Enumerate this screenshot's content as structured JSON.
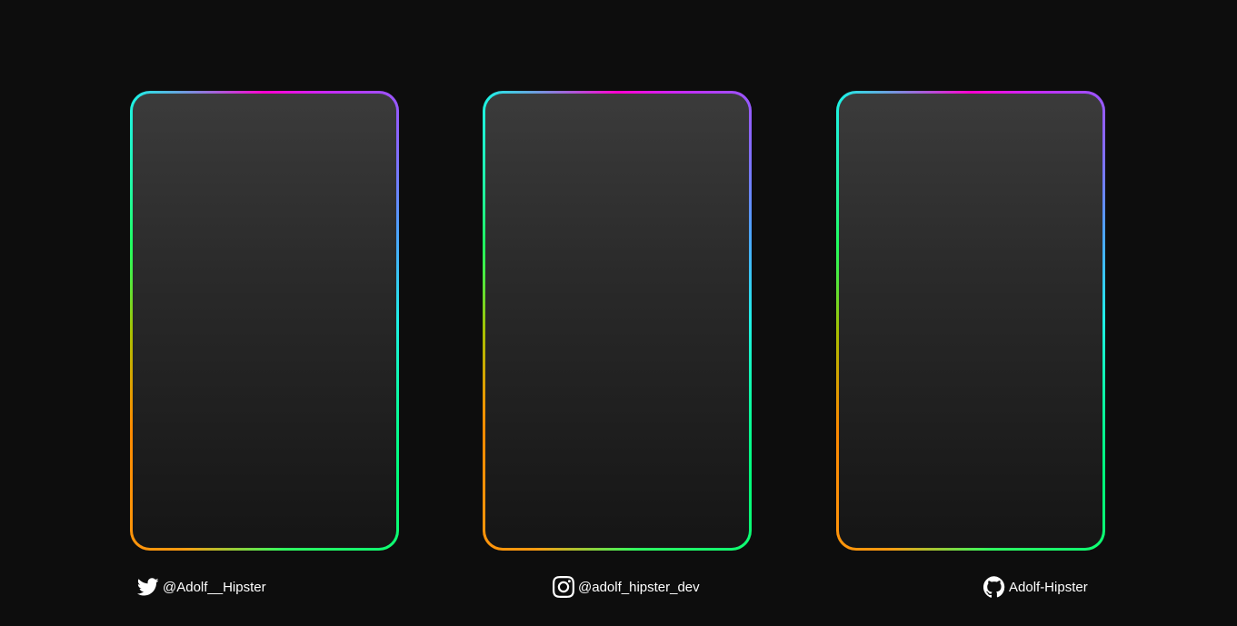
{
  "cards": [
    {
      "id": "card-1"
    },
    {
      "id": "card-2"
    },
    {
      "id": "card-3"
    }
  ],
  "colors": {
    "background": "#0d0d0d",
    "gradient": [
      "#ff00d0",
      "#4fa0ff",
      "#1ff0e6",
      "#00ff7a",
      "#ff8a00"
    ]
  },
  "socials": {
    "twitter": {
      "icon": "twitter-icon",
      "handle": "@Adolf__Hipster"
    },
    "instagram": {
      "icon": "instagram-icon",
      "handle": "@adolf_hipster_dev"
    },
    "github": {
      "icon": "github-icon",
      "handle": "Adolf-Hipster"
    }
  }
}
